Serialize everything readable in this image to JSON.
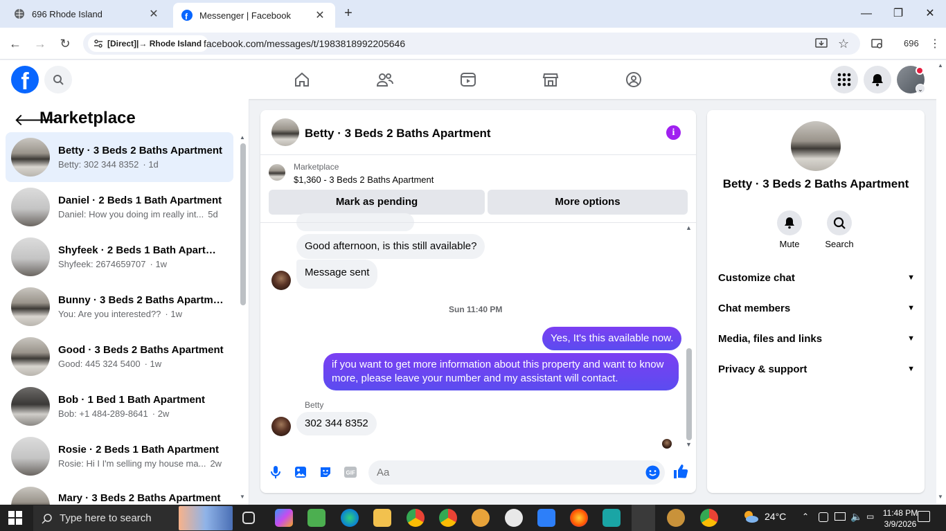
{
  "browser": {
    "tabs": [
      {
        "title": "696 Rhode Island"
      },
      {
        "title": "Messenger | Facebook"
      }
    ],
    "site_chip": "[Direct]|→ Rhode Island",
    "url": "facebook.com/messages/t/1983818992205646",
    "profile_count": "696"
  },
  "left_panel": {
    "title": "Marketplace",
    "conversations": [
      {
        "name": "Betty · 3 Beds 2 Baths Apartment",
        "preview": "Betty: 302 344 8352",
        "date": "1d",
        "active": true
      },
      {
        "name": "Daniel · 2 Beds 1 Bath Apartment",
        "preview": "Daniel: How you doing im really int...",
        "date": "5d"
      },
      {
        "name": "Shyfeek · 2 Beds 1 Bath Apartme...",
        "preview": "Shyfeek: 2674659707",
        "date": "1w"
      },
      {
        "name": "Bunny · 3 Beds 2 Baths Apartment",
        "preview": "You: Are you interested??",
        "date": "1w"
      },
      {
        "name": "Good · 3 Beds 2 Baths Apartment",
        "preview": "Good: 445 324 5400",
        "date": "1w"
      },
      {
        "name": "Bob · 1 Bed 1 Bath Apartment",
        "preview": "Bob: +1 484-289-8641",
        "date": "2w"
      },
      {
        "name": "Rosie · 2 Beds 1 Bath Apartment",
        "preview": "Rosie: Hi I I'm selling my house ma...",
        "date": "2w"
      },
      {
        "name": "Mary · 3 Beds 2 Baths Apartment",
        "preview": "",
        "date": ""
      }
    ]
  },
  "chat": {
    "title": "Betty · 3 Beds 2 Baths Apartment",
    "marketplace_label": "Marketplace",
    "listing": "$1,360 - 3 Beds 2 Baths Apartment",
    "mark_pending": "Mark as pending",
    "more_options": "More options",
    "messages": {
      "m1": "Good afternoon, is this still available?",
      "m2": "Message sent",
      "timestamp": "Sun 11:40 PM",
      "m3": "Yes, It's this available now.",
      "m4": "if you want to get more information about this property and want to know more, please leave your number and my assistant will contact.",
      "sender": "Betty",
      "m5": "302 344 8352"
    },
    "input_placeholder": "Aa"
  },
  "right_panel": {
    "title": "Betty · 3 Beds 2 Baths Apartment",
    "mute": "Mute",
    "search": "Search",
    "rows": [
      "Customize chat",
      "Chat members",
      "Media, files and links",
      "Privacy & support"
    ]
  },
  "taskbar": {
    "search_placeholder": "Type here to search",
    "temperature": "24°C",
    "time": "11:48 PM",
    "date": "3/9/2026"
  },
  "colors": {
    "fb_blue": "#0866ff",
    "outgoing_bubble": "#5b4cf0",
    "active_conv": "#e7f0fd",
    "info_purple": "#a020f0"
  }
}
